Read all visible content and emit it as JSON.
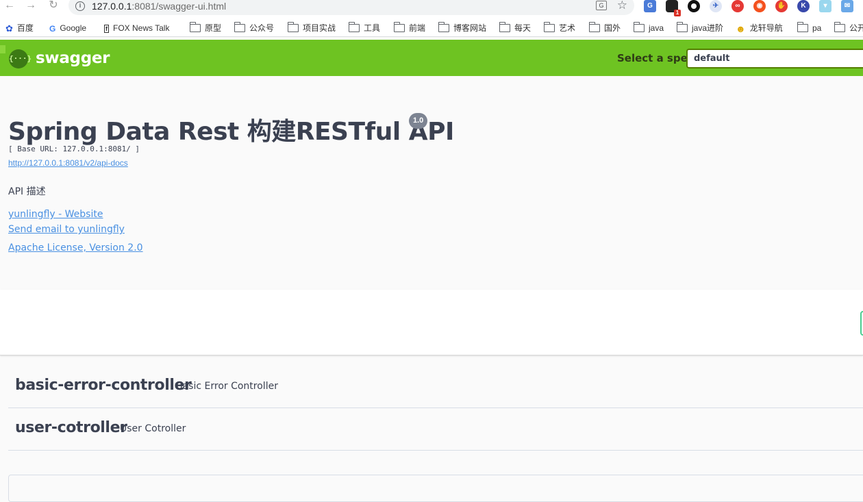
{
  "browser": {
    "url_host": "127.0.0.1",
    "url_rest": ":8081/swagger-ui.html",
    "translate_icon": "G",
    "extension_badge": "1"
  },
  "bookmarks": [
    {
      "label": "百度",
      "icon": "baidu-icon"
    },
    {
      "label": "Google",
      "icon": "google-icon"
    },
    {
      "label": "FOX News Talk",
      "icon": "fox-icon"
    },
    {
      "label": "原型",
      "icon": "folder-icon"
    },
    {
      "label": "公众号",
      "icon": "folder-icon"
    },
    {
      "label": "项目实战",
      "icon": "folder-icon"
    },
    {
      "label": "工具",
      "icon": "folder-icon"
    },
    {
      "label": "前端",
      "icon": "folder-icon"
    },
    {
      "label": "博客网站",
      "icon": "folder-icon"
    },
    {
      "label": "每天",
      "icon": "folder-icon"
    },
    {
      "label": "艺术",
      "icon": "folder-icon"
    },
    {
      "label": "国外",
      "icon": "folder-icon"
    },
    {
      "label": "java",
      "icon": "folder-icon"
    },
    {
      "label": "java进阶",
      "icon": "folder-icon"
    },
    {
      "label": "龙轩导航",
      "icon": "longxuan-icon"
    },
    {
      "label": "pa",
      "icon": "folder-icon"
    },
    {
      "label": "公开",
      "icon": "folder-icon"
    }
  ],
  "topbar": {
    "logo_glyph": "{···}",
    "logo_text": "swagger",
    "spec_label": "Select a spec",
    "spec_value": "default",
    "color": "#6ec322"
  },
  "info": {
    "title": "Spring Data Rest 构建RESTful API",
    "version": "1.0",
    "base_url": "[ Base URL: 127.0.0.1:8081/ ]",
    "docs_link": "http://127.0.0.1:8081/v2/api-docs",
    "description": "API 描述",
    "website_link": "yunlingfly - Website",
    "email_link": "Send email to yunlingfly",
    "license_link": "Apache License, Version 2.0"
  },
  "tags": [
    {
      "name": "basic-error-controller",
      "description": "Basic Error Controller"
    },
    {
      "name": "user-cotroller",
      "description": "User Cotroller"
    }
  ]
}
